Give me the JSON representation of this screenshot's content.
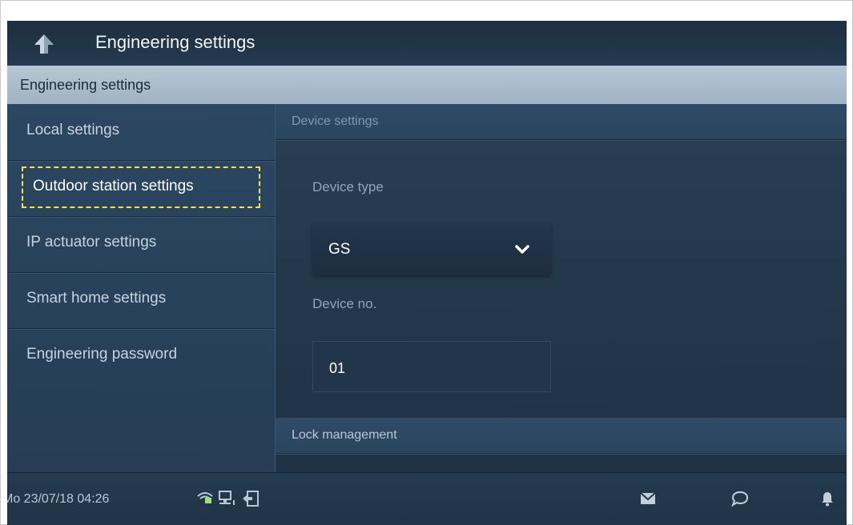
{
  "window": {
    "title": "Engineering settings",
    "back_icon": "back-arrow-icon"
  },
  "section_header": "Engineering settings",
  "sidebar": {
    "items": [
      {
        "label": "Local settings",
        "active": false
      },
      {
        "label": "Outdoor station settings",
        "active": true
      },
      {
        "label": "IP actuator settings",
        "active": false
      },
      {
        "label": "Smart home settings",
        "active": false
      },
      {
        "label": "Engineering password",
        "active": false
      }
    ]
  },
  "main": {
    "device_settings_header": "Device settings",
    "device_type_label": "Device type",
    "device_type_value": "GS",
    "device_no_label": "Device no.",
    "device_no_value": "01",
    "lock_management_header": "Lock management"
  },
  "statusbar": {
    "datetime": "Mo 23/07/18  04:26",
    "icons": [
      "wifi-icon",
      "network-icon",
      "door-exit-icon",
      "mail-icon",
      "chat-icon",
      "bell-icon"
    ]
  },
  "colors": {
    "focus_outline": "#f4e43a",
    "header_band": "#b7c7d4",
    "screen_bg": "#24384c"
  }
}
